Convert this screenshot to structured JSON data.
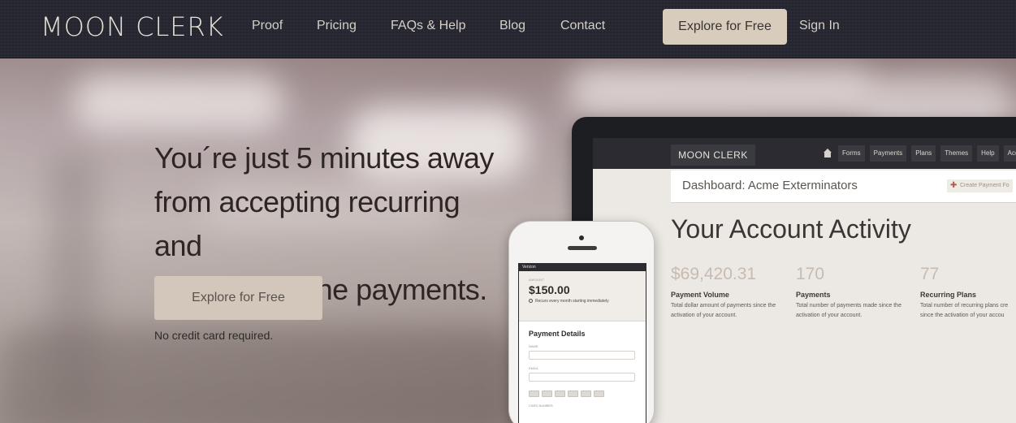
{
  "header": {
    "logo": "MOON CLERK",
    "nav": [
      {
        "label": "Proof"
      },
      {
        "label": "Pricing"
      },
      {
        "label": "FAQs & Help"
      },
      {
        "label": "Blog"
      },
      {
        "label": "Contact"
      }
    ],
    "cta_label": "Explore for Free",
    "signin_label": "Sign In"
  },
  "hero": {
    "headline_line1": "You´re just 5 minutes away",
    "headline_line2": "from accepting recurring and",
    "headline_line3": "one-time online payments.",
    "cta_label": "Explore for Free",
    "note": "No credit card required."
  },
  "laptop": {
    "logo": "MOON CLERK",
    "menu": [
      "Forms",
      "Payments",
      "Plans",
      "Themes",
      "Help",
      "Acc"
    ],
    "dashboard_title": "Dashboard: Acme Exterminators",
    "create_button": "Create Payment Fo",
    "heading": "Your Account Activity",
    "stats": [
      {
        "value": "$69,420.31",
        "label": "Payment Volume",
        "desc_line1": "Total dollar amount of payments since the",
        "desc_line2": "activation of your account."
      },
      {
        "value": "170",
        "label": "Payments",
        "desc_line1": "Total number of payments made since the",
        "desc_line2": "activation of your account."
      },
      {
        "value": "77",
        "label": "Recurring Plans",
        "desc_line1": "Total number of recurring plans cre",
        "desc_line2": "since the activation of your accou"
      }
    ]
  },
  "phone": {
    "carrier": "Verizon",
    "amount_label": "AMOUNT",
    "amount": "$150.00",
    "recur_text": "Recurs every month starting immediately",
    "section_title": "Payment Details",
    "field_name": "NAME",
    "field_email": "EMAIL",
    "field_card": "CARD NUMBER"
  },
  "colors": {
    "nav_bg": "#25262f",
    "cta_bg": "#d8cdbd",
    "hero_cta_bg": "#d3c7bb",
    "headline": "#2d2624"
  }
}
